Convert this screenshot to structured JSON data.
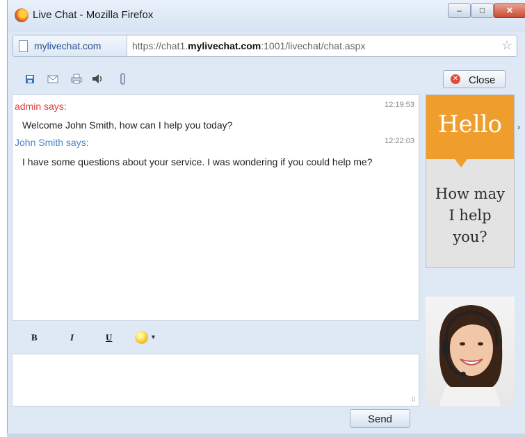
{
  "window": {
    "title": "Live Chat - Mozilla Firefox",
    "controls": {
      "minimize": "–",
      "maximize": "□",
      "close": "✕"
    }
  },
  "addressbar": {
    "site": "mylivechat.com",
    "url_prefix": "https://chat1.",
    "url_domain": "mylivechat.com",
    "url_suffix": ":1001/livechat/chat.aspx",
    "bookmark_icon": "☆"
  },
  "toolbar": {
    "icons": [
      "save-icon",
      "email-icon",
      "print-icon",
      "sound-icon",
      "attach-icon"
    ],
    "close_label": "Close"
  },
  "chat": {
    "messages": [
      {
        "sender": "admin says:",
        "time": "12:19:53",
        "text": "Welcome John Smith, how can I help you today?"
      },
      {
        "sender": "John Smith says:",
        "time": "12:22:03",
        "text": "I have some questions about your service. I was wondering if you could help me?"
      }
    ]
  },
  "format": {
    "bold": "B",
    "italic": "I",
    "underline": "U"
  },
  "input": {
    "value": "",
    "grip": "⠿"
  },
  "send_label": "Send",
  "promo": {
    "hello": "Hello",
    "line1": "How may",
    "line2": "I help",
    "line3": "you?",
    "expand": "›"
  },
  "colors": {
    "admin": "#e03a3a",
    "user": "#4a86c6",
    "promo_orange": "#ef9e2e"
  }
}
